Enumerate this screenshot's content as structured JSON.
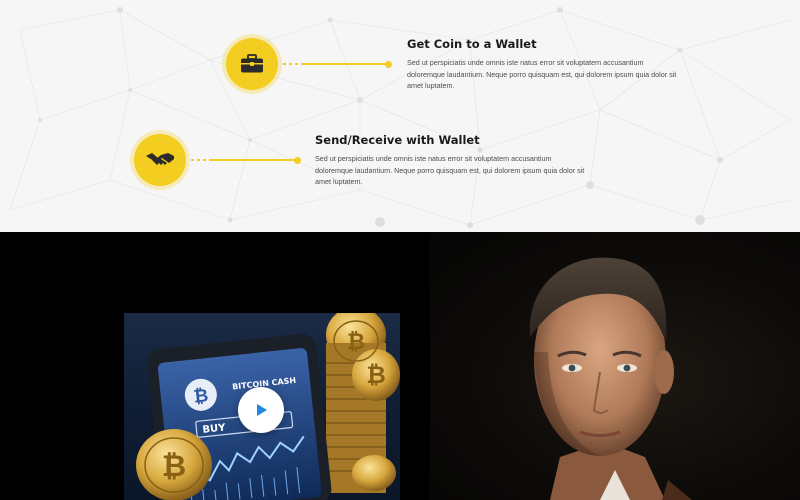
{
  "features": [
    {
      "icon": "briefcase-icon",
      "title": "Get Coin to a Wallet",
      "description": "Sed ut perspiciatis unde omnis iste natus error sit voluptatem accusantium doloremque laudantium. Neque porro quisquam est, qui dolorem ipsum quia dolor sit amet luptatem."
    },
    {
      "icon": "handshake-icon",
      "title": "Send/Receive with Wallet",
      "description": "Sed ut perspiciatis unde omnis iste natus error sit voluptatem accusantium doloremque laudantium. Neque porro quisquam est, qui dolorem ipsum quia dolor sit amet luptatem."
    }
  ],
  "video": {
    "play_icon": "play-icon",
    "thumbnail_labels": {
      "brand": "BITCOIN CASH",
      "buy": "BUY"
    }
  },
  "colors": {
    "accent": "#f3cd1f",
    "dark_section": "#000000",
    "light_section": "#f6f6f6",
    "play_accent": "#1e88e5"
  }
}
